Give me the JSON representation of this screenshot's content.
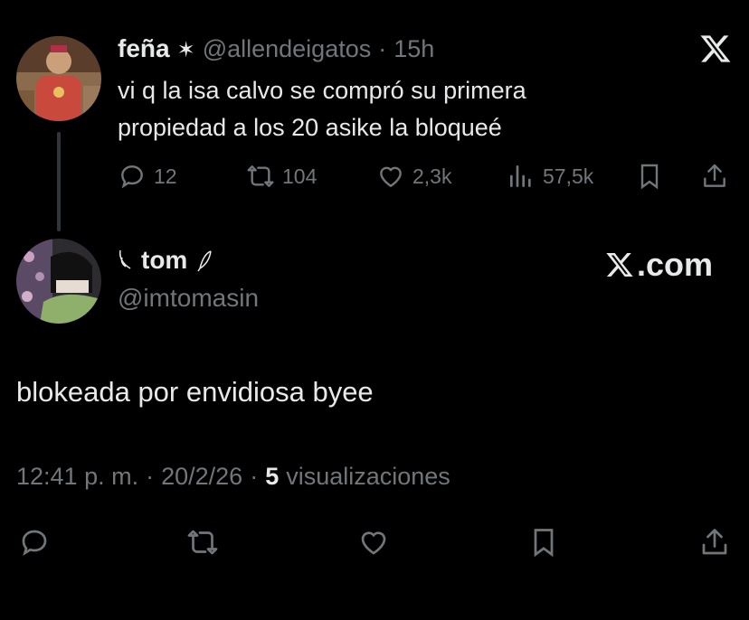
{
  "quoted_tweet": {
    "display_name": "feña",
    "star_glyph": "✶",
    "handle": "@allendeigatos",
    "separator": "·",
    "age": "15h",
    "text_line1": "vi q la isa calvo se compró su primera",
    "text_line2": "propiedad a los 20 asike la bloqueé",
    "replies": "12",
    "reposts": "104",
    "likes": "2,3k",
    "views": "57,5k",
    "x_logo": "𝕏"
  },
  "main_tweet": {
    "display_name": "tom",
    "handle": "@imtomasin",
    "text": "blokeada por envidiosa byee",
    "time": "12:41 p. m.",
    "dot1": "·",
    "date": "20/2/26",
    "dot2": "·",
    "views_count": "5",
    "views_label": "visualizaciones"
  },
  "brand": {
    "logo_glyph": "𝕏",
    "domain": ".com"
  },
  "icons": [
    "reply-icon",
    "repost-icon",
    "like-icon",
    "views-icon",
    "bookmark-icon",
    "share-icon",
    "x-logo-icon",
    "leaf-icon"
  ],
  "colors": {
    "background": "#000000",
    "text": "#e7e9ea",
    "muted": "#71767b",
    "thread_line": "#333639"
  }
}
